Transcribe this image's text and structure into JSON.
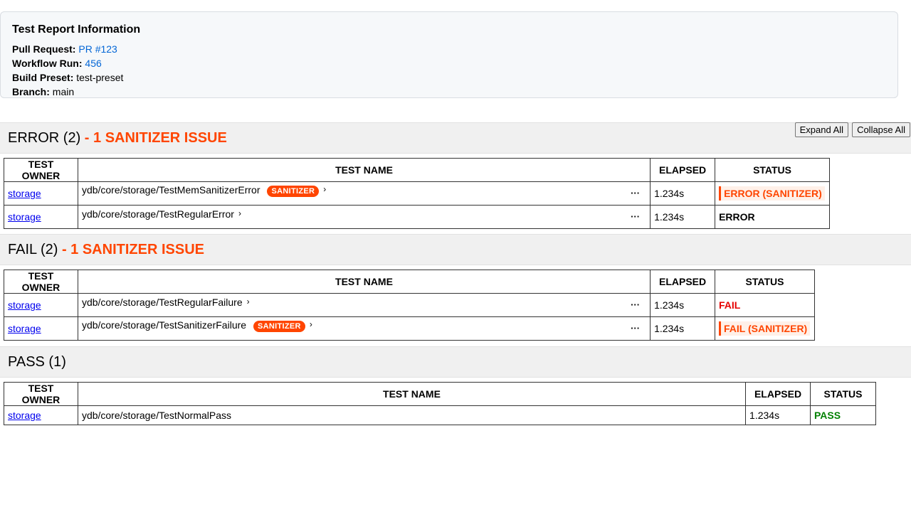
{
  "info": {
    "title": "Test Report Information",
    "pr_label": "Pull Request:",
    "pr_value": "PR #123",
    "run_label": "Workflow Run:",
    "run_value": "456",
    "preset_label": "Build Preset:",
    "preset_value": "test-preset",
    "branch_label": "Branch:",
    "branch_value": "main"
  },
  "toolbar": {
    "expand": "Expand All",
    "collapse": "Collapse All"
  },
  "columns": {
    "owner": "TEST OWNER",
    "name": "TEST NAME",
    "elapsed": "ELAPSED",
    "status": "STATUS"
  },
  "sections": [
    {
      "title": "ERROR (2)",
      "issue": " - 1 SANITIZER ISSUE",
      "rows": [
        {
          "owner": "storage",
          "name": "ydb/core/storage/TestMemSanitizerError",
          "badge": "SANITIZER",
          "elapsed": "1.234s",
          "status": "ERROR (SANITIZER)"
        },
        {
          "owner": "storage",
          "name": "ydb/core/storage/TestRegularError",
          "elapsed": "1.234s",
          "status": "ERROR"
        }
      ]
    },
    {
      "title": "FAIL (2)",
      "issue": " - 1 SANITIZER ISSUE",
      "rows": [
        {
          "owner": "storage",
          "name": "ydb/core/storage/TestRegularFailure",
          "elapsed": "1.234s",
          "status": "FAIL"
        },
        {
          "owner": "storage",
          "name": "ydb/core/storage/TestSanitizerFailure",
          "badge": "SANITIZER",
          "elapsed": "1.234s",
          "status": "FAIL (SANITIZER)"
        }
      ]
    },
    {
      "title": "PASS (1)",
      "rows": [
        {
          "owner": "storage",
          "name": "ydb/core/storage/TestNormalPass",
          "elapsed": "1.234s",
          "status": "PASS"
        }
      ]
    }
  ],
  "icons": {
    "chevron": "chevron-right-icon",
    "more": "more-dots-icon"
  },
  "colors": {
    "accent": "#ff4500",
    "fail": "#e60000",
    "pass": "#008000",
    "link": "#0366d6"
  }
}
